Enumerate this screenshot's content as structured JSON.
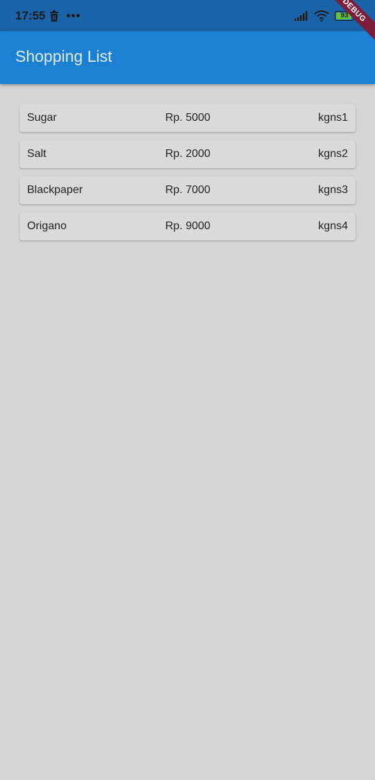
{
  "status_bar": {
    "time": "17:55",
    "battery_level": "93",
    "icons": [
      "trash-icon",
      "more-dots-icon",
      "signal-icon",
      "wifi-icon",
      "battery-icon"
    ]
  },
  "app_bar": {
    "title": "Shopping List"
  },
  "debug_banner": "DEBUG",
  "items": [
    {
      "name": "Sugar",
      "price": "Rp. 5000",
      "qty": "kgns1"
    },
    {
      "name": "Salt",
      "price": "Rp. 2000",
      "qty": "kgns2"
    },
    {
      "name": "Blackpaper",
      "price": "Rp. 7000",
      "qty": "kgns3"
    },
    {
      "name": "Origano",
      "price": "Rp. 9000",
      "qty": "kgns4"
    }
  ],
  "colors": {
    "status_bar": "#1a63a8",
    "app_bar": "#1c81d2",
    "background": "#d5d5d5",
    "card": "#dadada",
    "debug_banner": "#7d1d3c"
  }
}
